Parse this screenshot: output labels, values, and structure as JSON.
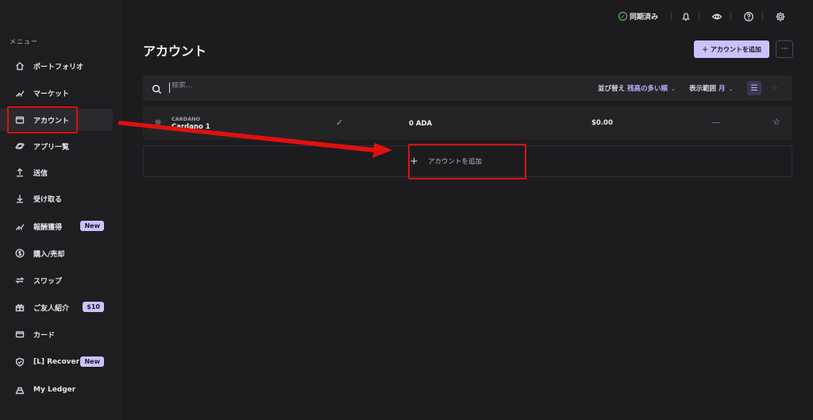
{
  "sidebar": {
    "menu_title": "メニュー",
    "items": [
      {
        "label": "ポートフォリオ",
        "icon": "home-icon"
      },
      {
        "label": "マーケット",
        "icon": "chart-icon"
      },
      {
        "label": "アカウント",
        "icon": "wallet-icon"
      },
      {
        "label": "アプリ一覧",
        "icon": "planet-icon"
      },
      {
        "label": "送信",
        "icon": "send-icon"
      },
      {
        "label": "受け取る",
        "icon": "receive-icon"
      },
      {
        "label": "報酬獲得",
        "icon": "earn-icon",
        "badge": "New"
      },
      {
        "label": "購入/売却",
        "icon": "coin-icon"
      },
      {
        "label": "スワップ",
        "icon": "swap-icon"
      },
      {
        "label": "ご友人紹介",
        "icon": "gift-icon",
        "badge": "$10"
      },
      {
        "label": "カード",
        "icon": "card-icon"
      },
      {
        "label": "[L] Recover",
        "icon": "shield-icon",
        "badge": "New"
      },
      {
        "label": "My Ledger",
        "icon": "ledger-icon"
      }
    ]
  },
  "topbar": {
    "sync_label": "同期済み"
  },
  "main": {
    "title": "アカウント",
    "add_account_label": "＋ アカウントを追加",
    "more_label": "···",
    "search": {
      "placeholder": "検索..."
    },
    "sort_label": "並び替え",
    "sort_value": "残高の多い順",
    "range_label": "表示範囲",
    "range_value": "月",
    "accounts": [
      {
        "currency": "CARDANO",
        "name": "Cardano 1",
        "balance": "0 ADA",
        "fiat": "$0.00"
      }
    ],
    "add_row_label": "アカウントを追加"
  },
  "colors": {
    "accent": "#c9c2ff",
    "sync_ok": "#6ecb63",
    "highlight": "#e01010",
    "background": "#1c1c1f"
  }
}
